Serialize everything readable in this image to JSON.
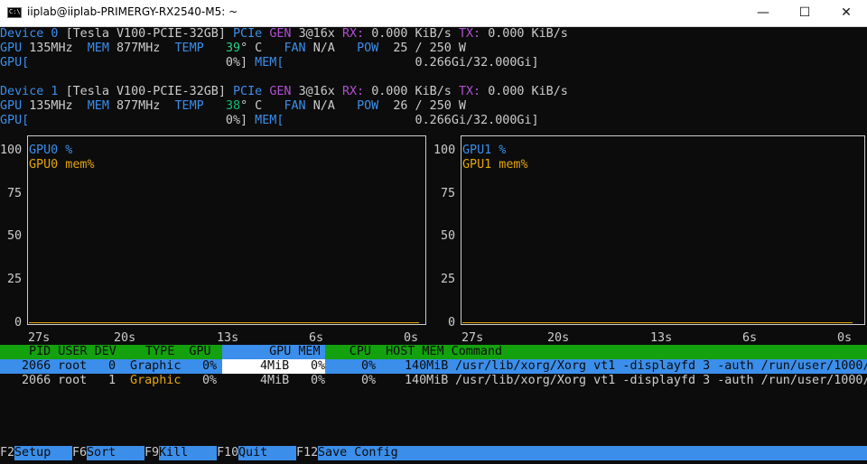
{
  "window": {
    "title": "iiplab@iiplab-PRIMERGY-RX2540-M5: ~",
    "icon": "terminal-icon",
    "buttons": {
      "minimize": "—",
      "maximize": "☐",
      "close": "✕"
    }
  },
  "devices": [
    {
      "label": "Device 0",
      "model": "[Tesla V100-PCIE-32GB]",
      "pcie_label": "PCIe",
      "gen_label": "GEN",
      "gen_value": "3@16x",
      "rx_label": "RX:",
      "rx_value": "0.000 KiB/s",
      "tx_label": "TX:",
      "tx_value": "0.000 KiB/s",
      "gpu_label": "GPU",
      "gpu_clock": "135MHz",
      "mem_label": "MEM",
      "mem_clock": "877MHz",
      "temp_label": "TEMP",
      "temp_value": "39",
      "temp_unit": "° C",
      "fan_label": "FAN",
      "fan_value": "N/A",
      "pow_label": "POW",
      "pow_value": "25 / 250 W",
      "gpu_bar_label": "GPU[",
      "gpu_bar_value": "0%]",
      "mem_bar_label": "MEM[",
      "mem_bar_value": "0.266Gi/32.000Gi]"
    },
    {
      "label": "Device 1",
      "model": "[Tesla V100-PCIE-32GB]",
      "pcie_label": "PCIe",
      "gen_label": "GEN",
      "gen_value": "3@16x",
      "rx_label": "RX:",
      "rx_value": "0.000 KiB/s",
      "tx_label": "TX:",
      "tx_value": "0.000 KiB/s",
      "gpu_label": "GPU",
      "gpu_clock": "135MHz",
      "mem_label": "MEM",
      "mem_clock": "877MHz",
      "temp_label": "TEMP",
      "temp_value": "38",
      "temp_unit": "° C",
      "fan_label": "FAN",
      "fan_value": "N/A",
      "pow_label": "POW",
      "pow_value": "26 / 250 W",
      "gpu_bar_label": "GPU[",
      "gpu_bar_value": "0%]",
      "mem_bar_label": "MEM[",
      "mem_bar_value": "0.266Gi/32.000Gi]"
    }
  ],
  "chart_data": [
    {
      "type": "line",
      "series": [
        {
          "name": "GPU0 %",
          "values": [
            0,
            0,
            0,
            0,
            0
          ],
          "color": "#3b8eea"
        },
        {
          "name": "GPU0 mem%",
          "values": [
            0,
            0,
            0,
            0,
            0
          ],
          "color": "#e5a50a"
        }
      ],
      "x": [
        "27s",
        "20s",
        "13s",
        "6s",
        "0s"
      ],
      "yticks": [
        "100",
        "75",
        "50",
        "25",
        "0"
      ],
      "ylim": [
        0,
        100
      ]
    },
    {
      "type": "line",
      "series": [
        {
          "name": "GPU1 %",
          "values": [
            0,
            0,
            0,
            0,
            0
          ],
          "color": "#3b8eea"
        },
        {
          "name": "GPU1 mem%",
          "values": [
            0,
            0,
            0,
            0,
            0
          ],
          "color": "#e5a50a"
        }
      ],
      "x": [
        "27s",
        "20s",
        "13s",
        "6s",
        "0s"
      ],
      "yticks": [
        "100",
        "75",
        "50",
        "25",
        "0"
      ],
      "ylim": [
        0,
        100
      ]
    }
  ],
  "process_table": {
    "header": " PID USER DEV    TYPE  GPU        GPU MEM    CPU  HOST MEM Command",
    "rows": [
      {
        "pid": "2066",
        "user": "root",
        "dev": "0",
        "type": "Graphic",
        "gpu": "0%",
        "gpu_mem": "4MiB",
        "gpu_mem_pct": "0%",
        "cpu": "0%",
        "host_mem": "140MiB",
        "command": "/usr/lib/xorg/Xorg vt1 -displayfd 3 -auth /run/user/1000/"
      },
      {
        "pid": "2066",
        "user": "root",
        "dev": "1",
        "type": "Graphic",
        "gpu": "0%",
        "gpu_mem": "4MiB",
        "gpu_mem_pct": "0%",
        "cpu": "0%",
        "host_mem": "140MiB",
        "command": "/usr/lib/xorg/Xorg vt1 -displayfd 3 -auth /run/user/1000/"
      }
    ]
  },
  "footer": [
    {
      "key": "F2",
      "label": "Setup"
    },
    {
      "key": "F6",
      "label": "Sort"
    },
    {
      "key": "F9",
      "label": "Kill"
    },
    {
      "key": "F10",
      "label": "Quit"
    },
    {
      "key": "F12",
      "label": "Save Config"
    }
  ],
  "colors": {
    "label": "#3b8eea",
    "pcie": "#b14fd1",
    "gen": "#cd3131",
    "temp": "#23d18b",
    "gpu_series": "#3b8eea",
    "mem_series": "#e5a50a",
    "table_header_bg": "#13a10e",
    "selected_row_bg": "#3b8eea"
  }
}
